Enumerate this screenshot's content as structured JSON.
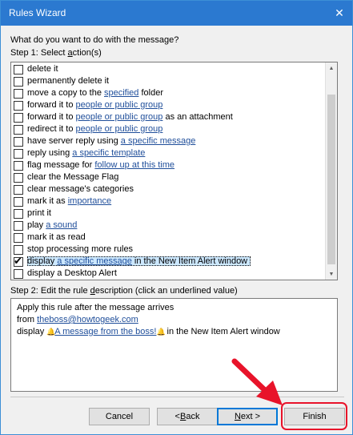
{
  "window": {
    "title": "Rules Wizard",
    "close_glyph": "✕"
  },
  "question": "What do you want to do with the message?",
  "step1": {
    "pre": "Step 1: Select ",
    "key": "a",
    "post": "ction(s)"
  },
  "actions": [
    {
      "parts": [
        {
          "t": "delete it"
        }
      ],
      "checked": false
    },
    {
      "parts": [
        {
          "t": "permanently delete it"
        }
      ],
      "checked": false
    },
    {
      "parts": [
        {
          "t": "move a copy to the "
        },
        {
          "t": "specified",
          "link": true
        },
        {
          "t": " folder"
        }
      ],
      "checked": false
    },
    {
      "parts": [
        {
          "t": "forward it to "
        },
        {
          "t": "people or public group",
          "link": true
        }
      ],
      "checked": false
    },
    {
      "parts": [
        {
          "t": "forward it to "
        },
        {
          "t": "people or public group",
          "link": true
        },
        {
          "t": " as an attachment"
        }
      ],
      "checked": false
    },
    {
      "parts": [
        {
          "t": "redirect it to "
        },
        {
          "t": "people or public group",
          "link": true
        }
      ],
      "checked": false
    },
    {
      "parts": [
        {
          "t": "have server reply using "
        },
        {
          "t": "a specific message",
          "link": true
        }
      ],
      "checked": false
    },
    {
      "parts": [
        {
          "t": "reply using "
        },
        {
          "t": "a specific template",
          "link": true
        }
      ],
      "checked": false
    },
    {
      "parts": [
        {
          "t": "flag message for "
        },
        {
          "t": "follow up at this time",
          "link": true
        }
      ],
      "checked": false
    },
    {
      "parts": [
        {
          "t": "clear the Message Flag"
        }
      ],
      "checked": false
    },
    {
      "parts": [
        {
          "t": "clear message's categories"
        }
      ],
      "checked": false
    },
    {
      "parts": [
        {
          "t": "mark it as "
        },
        {
          "t": "importance",
          "link": true
        }
      ],
      "checked": false
    },
    {
      "parts": [
        {
          "t": "print it"
        }
      ],
      "checked": false
    },
    {
      "parts": [
        {
          "t": "play "
        },
        {
          "t": "a sound",
          "link": true
        }
      ],
      "checked": false
    },
    {
      "parts": [
        {
          "t": "mark it as read"
        }
      ],
      "checked": false
    },
    {
      "parts": [
        {
          "t": "stop processing more rules"
        }
      ],
      "checked": false
    },
    {
      "parts": [
        {
          "t": "display "
        },
        {
          "t": "a specific message",
          "link": true
        },
        {
          "t": " in the New Item Alert window"
        }
      ],
      "checked": true,
      "selected": true
    },
    {
      "parts": [
        {
          "t": "display a Desktop Alert"
        }
      ],
      "checked": false
    }
  ],
  "step2": {
    "pre": "Step 2: Edit the rule ",
    "key": "d",
    "post": "escription (click an underlined value)"
  },
  "description": {
    "line1": "Apply this rule after the message arrives",
    "line2_prefix": "from ",
    "line2_link": "theboss@howtogeek.com",
    "line3_prefix": "display ",
    "line3_link": "A message from the boss!",
    "line3_suffix": " in the New Item Alert window"
  },
  "buttons": {
    "cancel": "Cancel",
    "back": {
      "glyph": "< ",
      "key": "B",
      "rest": "ack"
    },
    "next": {
      "key": "N",
      "rest": "ext >"
    },
    "finish": "Finish"
  },
  "colors": {
    "title_bar": "#2b79d0",
    "link": "#1f4e9a",
    "selection": "#cce8ff",
    "highlight": "#e8132a"
  }
}
